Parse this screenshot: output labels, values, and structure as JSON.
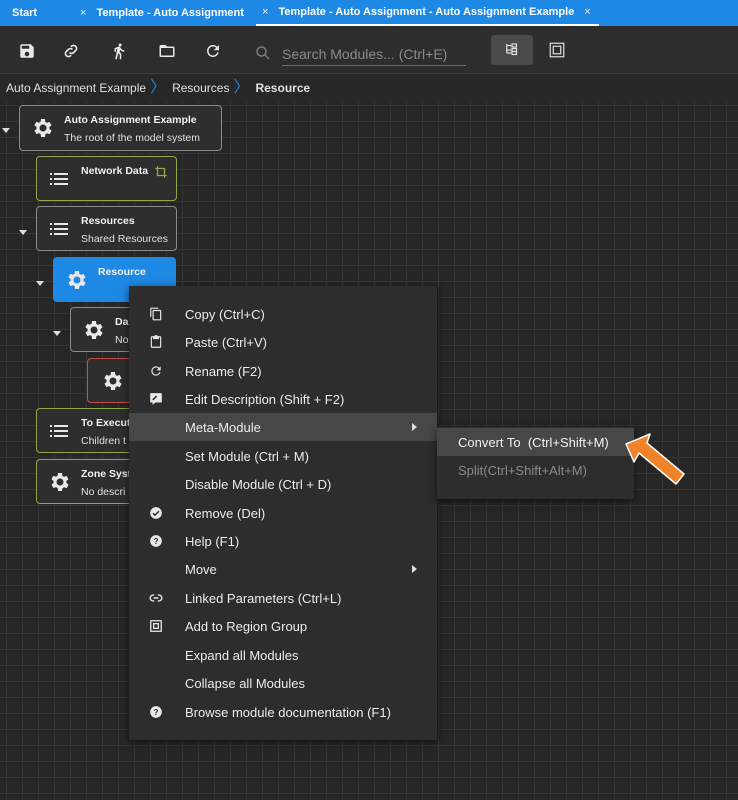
{
  "tabs": [
    {
      "label": "Start"
    },
    {
      "label": "Template - Auto Assignment"
    },
    {
      "label": "Template - Auto Assignment - Auto Assignment Example"
    }
  ],
  "tab_close_glyph": "×",
  "toolbar": {
    "buttons": [
      "save-icon",
      "link-icon",
      "run-icon",
      "folder-icon",
      "refresh-icon"
    ],
    "search_placeholder": "Search Modules... (Ctrl+E)"
  },
  "breadcrumb": [
    "Auto Assignment Example",
    "Resources",
    "Resource"
  ],
  "nodes": {
    "root": {
      "title": "Auto Assignment Example",
      "desc": "The root of the model system"
    },
    "network": {
      "title": "Network Data"
    },
    "resources": {
      "title": "Resources",
      "desc": "Shared Resources"
    },
    "resource": {
      "title": "Resource"
    },
    "data": {
      "title": "Da",
      "desc": "No"
    },
    "to_execute": {
      "title": "To Execut",
      "desc": "Children t"
    },
    "zone": {
      "title": "Zone Syst",
      "desc": "No descri"
    }
  },
  "context_menu": [
    {
      "label": "Copy (Ctrl+C)",
      "icon": "copy-icon"
    },
    {
      "label": "Paste (Ctrl+V)",
      "icon": "paste-icon"
    },
    {
      "label": "Rename (F2)",
      "icon": "rename-icon"
    },
    {
      "label": "Edit Description (Shift + F2)",
      "icon": "edit-description-icon"
    },
    {
      "label": "Meta-Module",
      "icon": "",
      "submenu": true,
      "highlighted": true
    },
    {
      "label": "Set Module (Ctrl + M)",
      "icon": ""
    },
    {
      "label": "Disable Module (Ctrl + D)",
      "icon": ""
    },
    {
      "label": "Remove (Del)",
      "icon": "remove-icon"
    },
    {
      "label": "Help (F1)",
      "icon": "help-icon"
    },
    {
      "label": "Move",
      "icon": "",
      "submenu": true
    },
    {
      "label": "Linked Parameters (Ctrl+L)",
      "icon": "link-icon"
    },
    {
      "label": "Add to Region Group",
      "icon": "region-group-icon"
    },
    {
      "label": "Expand all Modules",
      "icon": ""
    },
    {
      "label": "Collapse all Modules",
      "icon": ""
    },
    {
      "label": "Browse module documentation (F1)",
      "icon": "help-icon"
    }
  ],
  "submenu": [
    {
      "label": "Convert To  (Ctrl+Shift+M)",
      "highlighted": true
    },
    {
      "label": "Split(Ctrl+Shift+Alt+M)",
      "disabled": true
    }
  ],
  "colors": {
    "accent": "#1e88e5",
    "annotation_arrow": "#f0822a",
    "node_green_border": "#8ea84a",
    "node_red_border": "#c64a4a"
  }
}
